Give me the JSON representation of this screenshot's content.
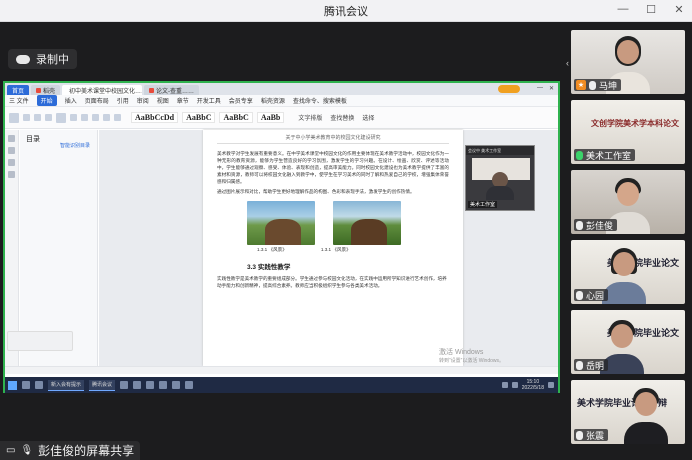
{
  "app": {
    "title": "腾讯会议",
    "window_controls": [
      "―",
      "☐",
      "✕"
    ]
  },
  "recording": {
    "label": "录制中"
  },
  "presenter": {
    "label": "彭佳俊的屏幕共享"
  },
  "shared_screen": {
    "tabs": [
      {
        "label": "首页",
        "type": "home"
      },
      {
        "label": "稻壳",
        "type": "normal"
      },
      {
        "label": "初中美术课堂中校园文化……",
        "type": "active"
      },
      {
        "label": "论文-查重……",
        "type": "normal"
      }
    ],
    "menu": [
      "三 文件",
      "开始",
      "插入",
      "页面布局",
      "引用",
      "审阅",
      "视图",
      "章节",
      "开发工具",
      "会员专享",
      "稻壳资源",
      "查找命令、搜索模板"
    ],
    "ribbon_styles": [
      "AaBbCcDd",
      "AaBbC",
      "AaBbC",
      "AaBb"
    ],
    "ribbon_tools": [
      "文字排版",
      "查找替换",
      "选择"
    ],
    "toc": {
      "title": "目录",
      "item": "智能识别目录"
    },
    "doc": {
      "header": "关于中小学美术教育中的校园文化建设研究",
      "para1": "美术教学对学生发展有重要意义。在中学美术课堂中校园文化的作用主要体现在美术教学活动中，校园文化作为一种无形的教育资源，能够为学生营造良好的学习氛围，激发学生的学习兴趣。在设计、绘画、欣赏、评述等活动中，学生能够通过观察、感受、体验、表现和创造，提高审美能力。同时校园文化建设也为美术教学提供了丰富的素材和资源，教师可以将校园文化融入到教学中，使学生在学习美术的同时了解和热爱自己的学校，增强集体荣誉感和归属感。",
      "para2": "通过图片展示和对比，帮助学生更好地理解作品的构图、色彩和表现手法，激发学生的创作热情。",
      "captions": [
        "1.3.1 《风景》",
        "1.3.1 《风景》"
      ],
      "section": "3.3  实践性教学",
      "para3": "实践性教学是美术教学的重要组成部分。学生通过参与校园文化活动，在实践中运用所学知识进行艺术创作，培养动手能力和创新精神，提高综合素养。教师应当积极组织学生参与各类美术活动。"
    },
    "video_inset": {
      "header": "会议中 美术工作室",
      "name": "美术工作室"
    },
    "activate_windows": {
      "line1": "激活 Windows",
      "line2": "转到“设置”以激活 Windows。"
    },
    "taskbar": {
      "apps": [
        "新入会有提示",
        "腾讯会议"
      ],
      "time": "15:10",
      "date": "2022/5/18"
    }
  },
  "participants": [
    {
      "name": "马坤",
      "mic": "off",
      "host": true,
      "board": ""
    },
    {
      "name": "美术工作室",
      "mic": "on",
      "host": false,
      "board": "文创学院美术学本科论文"
    },
    {
      "name": "彭佳俊",
      "mic": "off",
      "host": false,
      "board": ""
    },
    {
      "name": "心园",
      "mic": "off",
      "host": false,
      "board": "美术学院毕业论文"
    },
    {
      "name": "岳明",
      "mic": "off",
      "host": false,
      "board": "美术学院毕业论文"
    },
    {
      "name": "张震",
      "mic": "off",
      "host": false,
      "board": "美术学院毕业论文答辩"
    }
  ]
}
